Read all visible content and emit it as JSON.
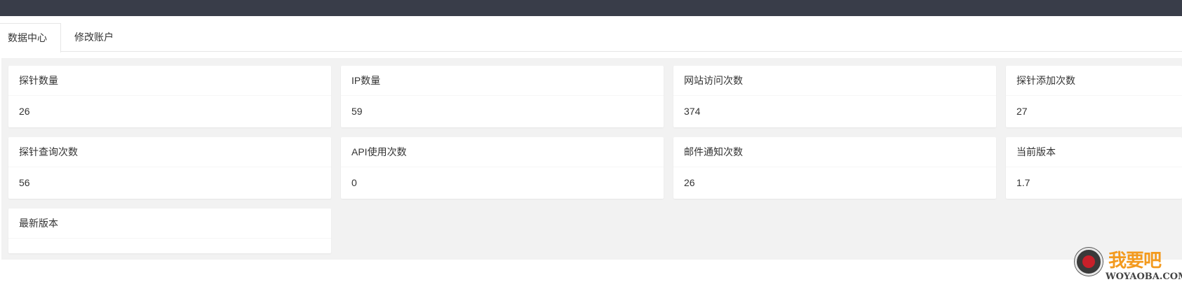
{
  "tabs": [
    {
      "label": "数据中心",
      "active": true
    },
    {
      "label": "修改账户",
      "active": false
    }
  ],
  "cards": [
    {
      "title": "探针数量",
      "value": "26"
    },
    {
      "title": "IP数量",
      "value": "59"
    },
    {
      "title": "网站访问次数",
      "value": "374"
    },
    {
      "title": "探针添加次数",
      "value": "27"
    },
    {
      "title": "探针查询次数",
      "value": "56"
    },
    {
      "title": "API使用次数",
      "value": "0"
    },
    {
      "title": "邮件通知次数",
      "value": "26"
    },
    {
      "title": "当前版本",
      "value": "1.7"
    },
    {
      "title": "最新版本",
      "value": ""
    }
  ],
  "watermark": {
    "cn": "我要吧",
    "en": "WOYAOBA.COM"
  },
  "colors": {
    "topbar": "#393d49",
    "content_bg": "#f2f2f2",
    "watermark_accent": "#f39a1e"
  }
}
